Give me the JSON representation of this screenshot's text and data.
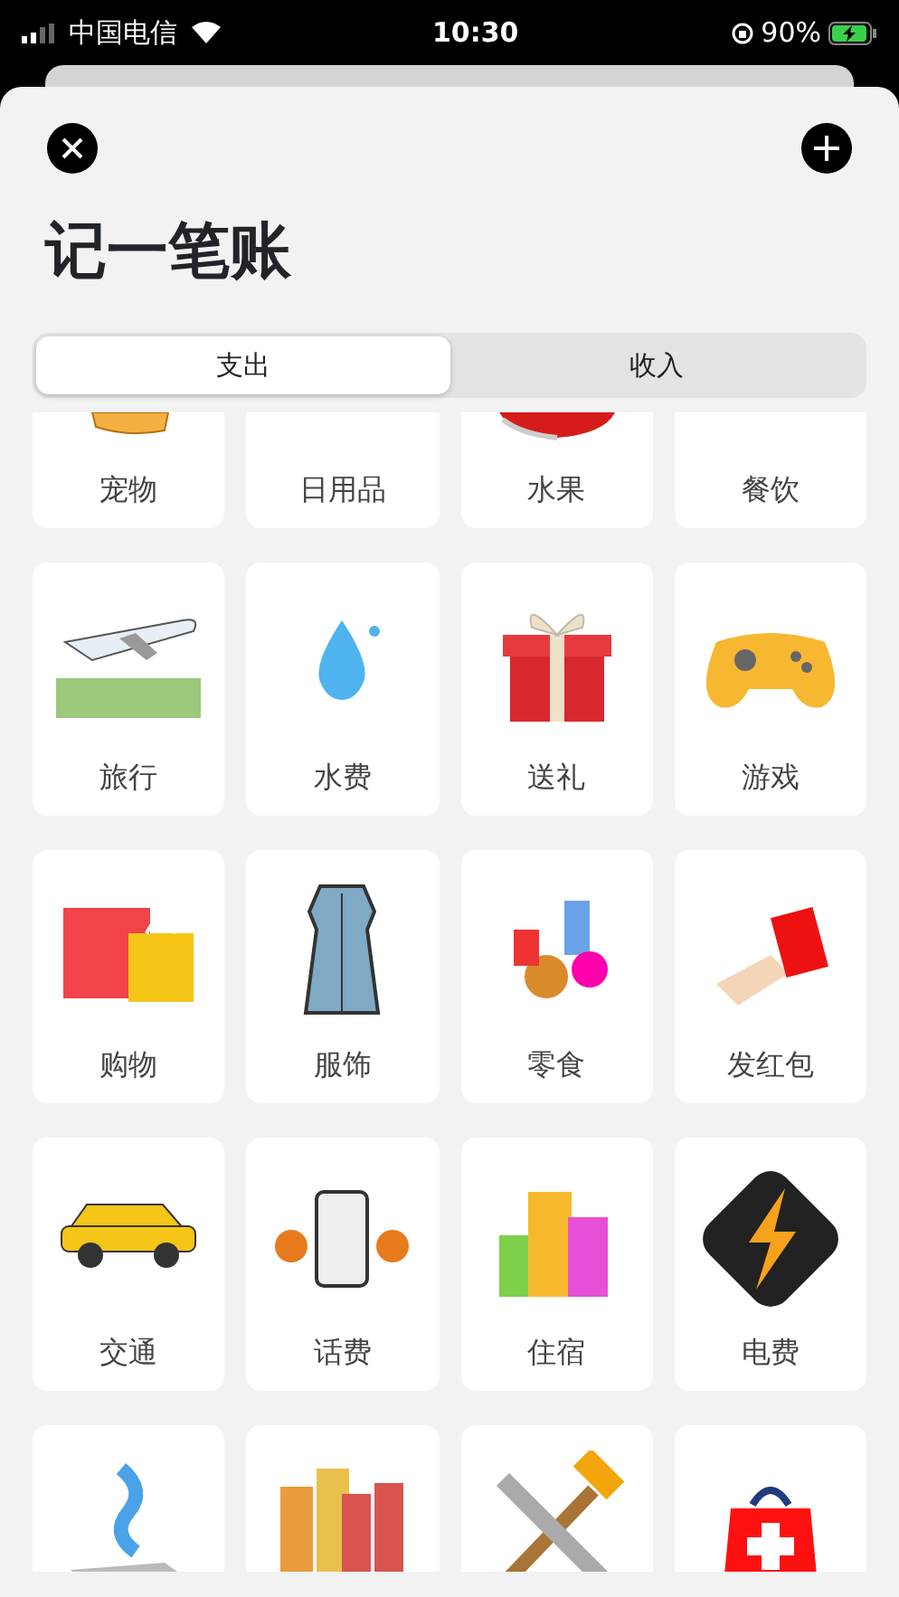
{
  "status_bar": {
    "carrier": "中国电信",
    "time": "10:30",
    "battery": "90%"
  },
  "sheet": {
    "title": "记一笔账"
  },
  "tabs": [
    {
      "label": "支出",
      "selected": true
    },
    {
      "label": "收入",
      "selected": false
    }
  ],
  "categories": [
    {
      "label": "宠物"
    },
    {
      "label": "日用品"
    },
    {
      "label": "水果"
    },
    {
      "label": "餐饮"
    },
    {
      "label": "旅行"
    },
    {
      "label": "水费"
    },
    {
      "label": "送礼"
    },
    {
      "label": "游戏"
    },
    {
      "label": "购物"
    },
    {
      "label": "服饰"
    },
    {
      "label": "零食"
    },
    {
      "label": "发红包"
    },
    {
      "label": "交通"
    },
    {
      "label": "话费"
    },
    {
      "label": "住宿"
    },
    {
      "label": "电费"
    }
  ]
}
